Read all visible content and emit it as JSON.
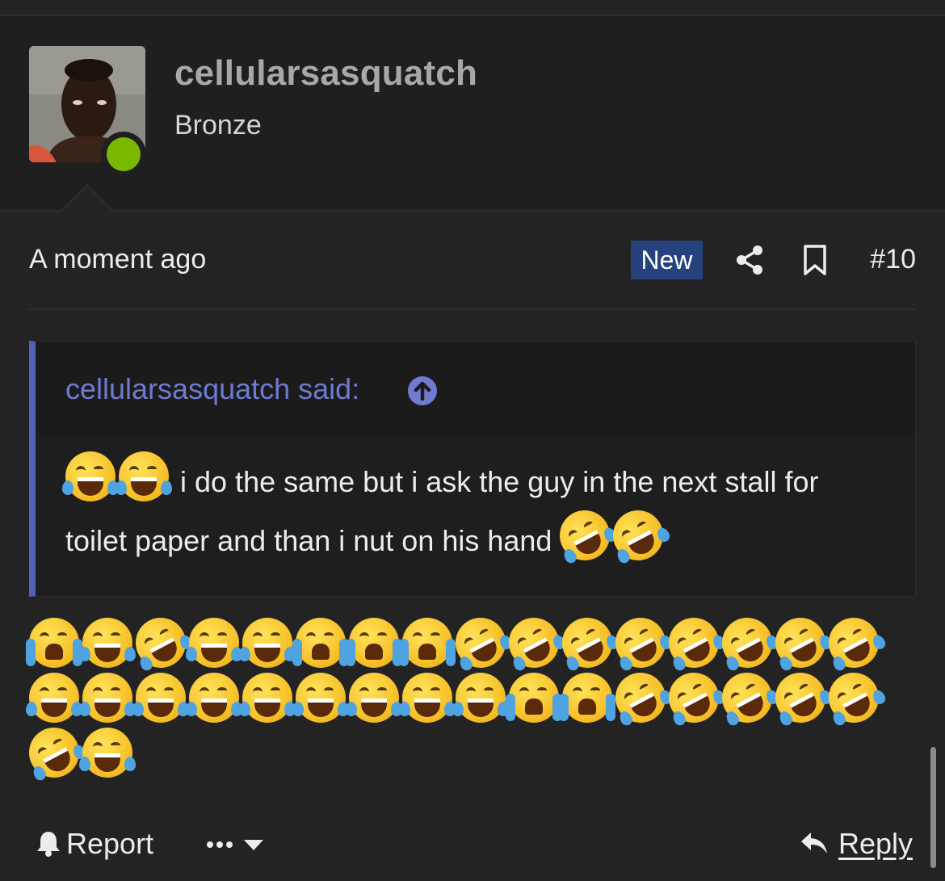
{
  "post": {
    "author": "cellularsasquatch",
    "author_title": "Bronze",
    "online": true,
    "date": "A moment ago",
    "badge_new": "New",
    "post_number": "#10"
  },
  "quote": {
    "author_said": "cellularsasquatch said:",
    "text_line1": "i do the same but i ask the guy in the next stall for",
    "text_line2": "toilet paper and than i nut on his hand",
    "leading_emojis": [
      "joy",
      "joy"
    ],
    "trailing_emojis": [
      "rofl",
      "rofl"
    ]
  },
  "message": {
    "emoji_rows": [
      [
        "sob",
        "joy",
        "rofl",
        "joy",
        "joy",
        "sob",
        "sob",
        "sob",
        "rofl",
        "rofl",
        "rofl",
        "rofl",
        "rofl",
        "rofl",
        "rofl",
        "rofl"
      ],
      [
        "joy",
        "joy",
        "joy",
        "joy",
        "joy",
        "joy",
        "joy",
        "joy",
        "joy",
        "sob",
        "sob",
        "rofl",
        "rofl",
        "rofl",
        "rofl",
        "rofl"
      ],
      [
        "rofl",
        "joy"
      ]
    ]
  },
  "actions": {
    "report": "Report",
    "more": "•••",
    "reply": "Reply"
  },
  "icons": {
    "share": "share-icon",
    "bookmark": "bookmark-icon",
    "quote_jump": "arrow-up-circle-icon",
    "report": "bell-icon",
    "reply": "reply-arrow-icon",
    "more": "chevron-down-icon"
  },
  "colors": {
    "background": "#232324",
    "header_bg": "#1f1f20",
    "new_badge": "#25427f",
    "quote_accent": "#5360b8",
    "quote_author": "#6e7bd0",
    "online": "#7ab800"
  }
}
